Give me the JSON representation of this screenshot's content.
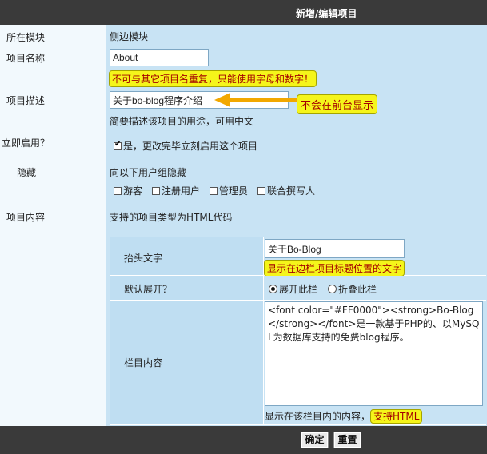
{
  "header": {
    "title": "新增/编辑项目"
  },
  "fields": {
    "module": {
      "label": "所在模块",
      "value": "侧边模块"
    },
    "name": {
      "label": "项目名称",
      "value": "About",
      "hint": "不可与其它项目名重复，只能使用字母和数字！"
    },
    "desc": {
      "label": "项目描述",
      "value": "关于bo-blog程序介绍",
      "callout": "不会在前台显示",
      "hint": "简要描述该项目的用途，可用中文"
    },
    "enable": {
      "label": "立即启用？",
      "checked": true,
      "text": "是，更改完毕立刻启用这个项目"
    },
    "hide": {
      "label": "隐藏",
      "intro": "向以下用户组隐藏",
      "groups": [
        {
          "label": "游客",
          "checked": false
        },
        {
          "label": "注册用户",
          "checked": false
        },
        {
          "label": "管理员",
          "checked": false
        },
        {
          "label": "联合撰写人",
          "checked": false
        }
      ]
    },
    "content": {
      "label": "项目内容",
      "intro": "支持的项目类型为HTML代码"
    }
  },
  "inner": {
    "heading": {
      "label": "抬头文字",
      "value": "关于Bo-Blog",
      "hint": "显示在边栏项目标题位置的文字"
    },
    "expand": {
      "label": "默认展开？",
      "options": [
        {
          "label": "展开此栏",
          "checked": true
        },
        {
          "label": "折叠此栏",
          "checked": false
        }
      ]
    },
    "body": {
      "label": "栏目内容",
      "code": "<font color=\"#FF0000\"><strong>Bo-Blog</strong></font>是一款基于PHP的、以MySQL为数据库支持的免费blog程序。",
      "hint_prefix": "显示在该栏目内的内容，",
      "hint_highlight": "支持HTML"
    }
  },
  "buttons": {
    "confirm": "确定",
    "reset": "重置"
  },
  "colors": {
    "row_bg": "#c8e3f4",
    "bar_bg": "#3a3a3a",
    "highlight": "#f5f51a",
    "arrow": "#f2a800"
  }
}
